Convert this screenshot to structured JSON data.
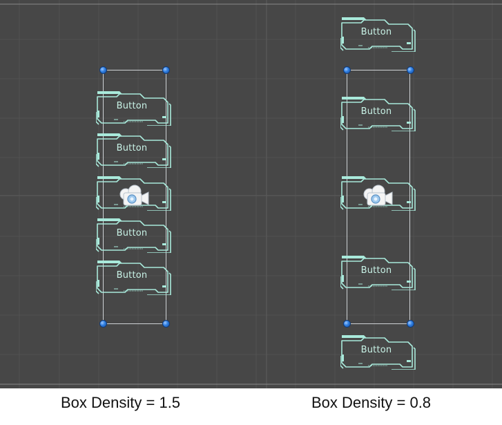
{
  "scene": {
    "background": "#474747",
    "button_label": "Button",
    "accent_color": "#a9eadb"
  },
  "panels": [
    {
      "caption": "Box Density = 1.5"
    },
    {
      "caption": "Box Density = 0.8"
    }
  ],
  "icons": [
    "camera-gizmo-icon"
  ]
}
